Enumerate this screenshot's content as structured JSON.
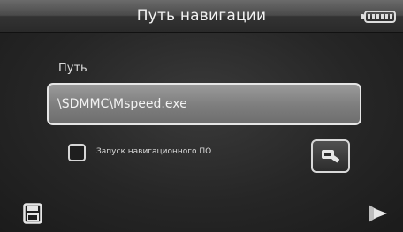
{
  "header": {
    "title": "Путь навигации",
    "battery_icon": "battery-icon"
  },
  "path": {
    "label": "Путь",
    "value": "\\SDMMC\\Mspeed.exe"
  },
  "autostart": {
    "label": "Запуск навигационного ПО",
    "checked": false
  },
  "icons": {
    "search": "search-icon",
    "save": "save-icon",
    "next": "next-arrow-icon"
  }
}
